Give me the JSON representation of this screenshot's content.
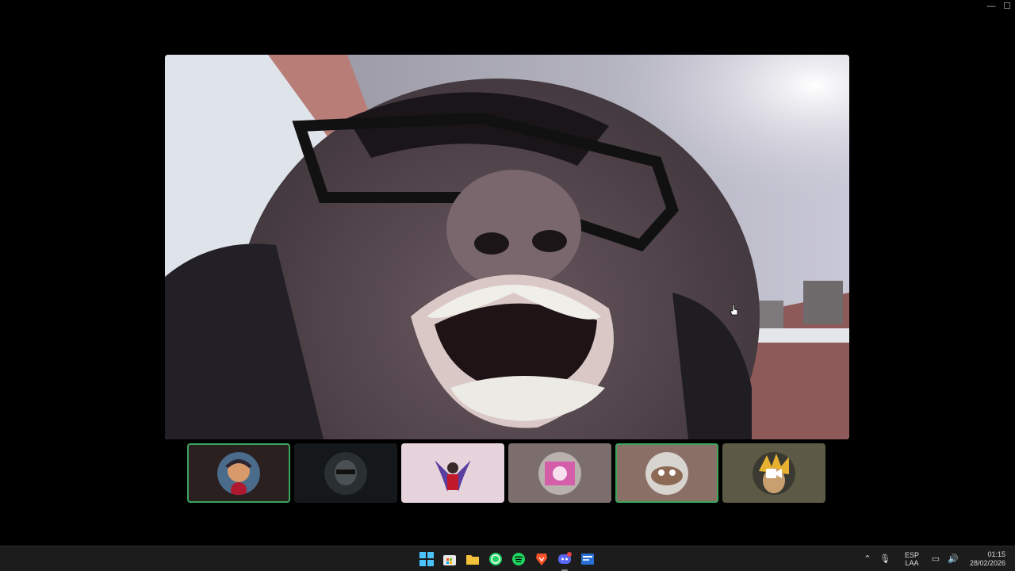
{
  "window": {
    "controls": {
      "minimize": "—",
      "maximize": "☐"
    }
  },
  "main_video": {
    "icon": "webcam-feed"
  },
  "participants": [
    {
      "id": "p1",
      "speaking": true,
      "bg": "#2b2020",
      "avatar": "anime-character-avatar"
    },
    {
      "id": "p2",
      "speaking": false,
      "bg": "#15181a",
      "avatar": "dark-mask-avatar"
    },
    {
      "id": "p3",
      "speaking": false,
      "bg": "#e6d3dc",
      "avatar": "winged-person-avatar"
    },
    {
      "id": "p4",
      "speaking": false,
      "bg": "#7b6e6c",
      "avatar": "pink-logo-avatar"
    },
    {
      "id": "p5",
      "speaking": true,
      "bg": "#8a6f66",
      "avatar": "meme-face-avatar"
    },
    {
      "id": "p6",
      "speaking": false,
      "bg": "#5c5a44",
      "avatar": "camera-icon",
      "camera_icon": true
    }
  ],
  "taskbar": {
    "apps": [
      {
        "name": "start",
        "icon": "windows-logo-icon"
      },
      {
        "name": "store",
        "icon": "store-icon"
      },
      {
        "name": "explorer",
        "icon": "folder-icon"
      },
      {
        "name": "whatsapp",
        "icon": "whatsapp-icon"
      },
      {
        "name": "spotify",
        "icon": "spotify-icon"
      },
      {
        "name": "brave",
        "icon": "brave-icon"
      },
      {
        "name": "discord",
        "icon": "discord-icon",
        "active": true
      },
      {
        "name": "app",
        "icon": "app-icon"
      }
    ],
    "tray": {
      "lang_top": "ESP",
      "lang_bottom": "LAA",
      "time": "01:15",
      "date": "28/02/2026"
    }
  }
}
